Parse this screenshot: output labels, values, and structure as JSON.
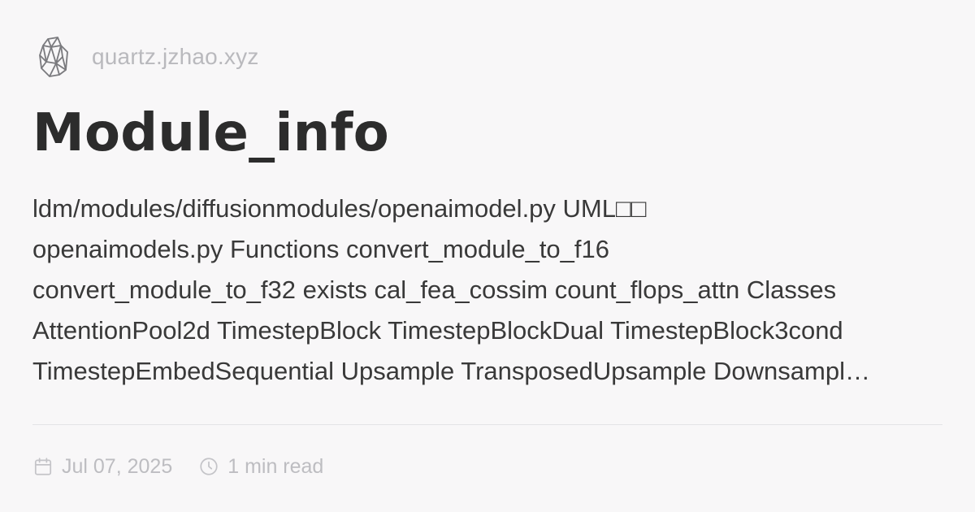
{
  "site": {
    "name": "quartz.jzhao.xyz",
    "logo_icon": "crystal-logo-icon"
  },
  "page": {
    "title": "Module_info",
    "summary_lines": [
      "ldm/modules/diffusionmodules/openaimodel.py UML□□",
      "openaimodels.py Functions convert_module_to_f16",
      "convert_module_to_f32 exists cal_fea_cossim count_flops_attn Classes",
      "AttentionPool2d TimestepBlock TimestepBlockDual TimestepBlock3cond",
      "TimestepEmbedSequential Upsample TransposedUpsample Downsampl…"
    ]
  },
  "meta": {
    "date": "Jul 07, 2025",
    "date_icon": "calendar-icon",
    "read_time": "1 min read",
    "read_icon": "clock-icon"
  },
  "colors": {
    "background": "#f8f7f8",
    "title": "#2c2c2c",
    "body_text": "#393939",
    "muted": "#bdbdc1",
    "divider": "#e4e4e6"
  }
}
